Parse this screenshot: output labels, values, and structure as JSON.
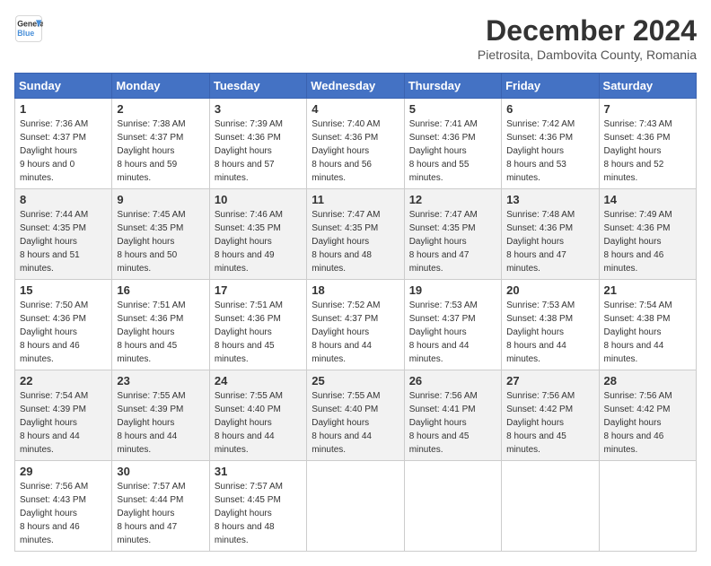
{
  "header": {
    "logo_line1": "General",
    "logo_line2": "Blue",
    "month": "December 2024",
    "location": "Pietrosita, Dambovita County, Romania"
  },
  "days_of_week": [
    "Sunday",
    "Monday",
    "Tuesday",
    "Wednesday",
    "Thursday",
    "Friday",
    "Saturday"
  ],
  "weeks": [
    [
      {
        "day": "1",
        "sunrise": "7:36 AM",
        "sunset": "4:37 PM",
        "daylight": "9 hours and 0 minutes."
      },
      {
        "day": "2",
        "sunrise": "7:38 AM",
        "sunset": "4:37 PM",
        "daylight": "8 hours and 59 minutes."
      },
      {
        "day": "3",
        "sunrise": "7:39 AM",
        "sunset": "4:36 PM",
        "daylight": "8 hours and 57 minutes."
      },
      {
        "day": "4",
        "sunrise": "7:40 AM",
        "sunset": "4:36 PM",
        "daylight": "8 hours and 56 minutes."
      },
      {
        "day": "5",
        "sunrise": "7:41 AM",
        "sunset": "4:36 PM",
        "daylight": "8 hours and 55 minutes."
      },
      {
        "day": "6",
        "sunrise": "7:42 AM",
        "sunset": "4:36 PM",
        "daylight": "8 hours and 53 minutes."
      },
      {
        "day": "7",
        "sunrise": "7:43 AM",
        "sunset": "4:36 PM",
        "daylight": "8 hours and 52 minutes."
      }
    ],
    [
      {
        "day": "8",
        "sunrise": "7:44 AM",
        "sunset": "4:35 PM",
        "daylight": "8 hours and 51 minutes."
      },
      {
        "day": "9",
        "sunrise": "7:45 AM",
        "sunset": "4:35 PM",
        "daylight": "8 hours and 50 minutes."
      },
      {
        "day": "10",
        "sunrise": "7:46 AM",
        "sunset": "4:35 PM",
        "daylight": "8 hours and 49 minutes."
      },
      {
        "day": "11",
        "sunrise": "7:47 AM",
        "sunset": "4:35 PM",
        "daylight": "8 hours and 48 minutes."
      },
      {
        "day": "12",
        "sunrise": "7:47 AM",
        "sunset": "4:35 PM",
        "daylight": "8 hours and 47 minutes."
      },
      {
        "day": "13",
        "sunrise": "7:48 AM",
        "sunset": "4:36 PM",
        "daylight": "8 hours and 47 minutes."
      },
      {
        "day": "14",
        "sunrise": "7:49 AM",
        "sunset": "4:36 PM",
        "daylight": "8 hours and 46 minutes."
      }
    ],
    [
      {
        "day": "15",
        "sunrise": "7:50 AM",
        "sunset": "4:36 PM",
        "daylight": "8 hours and 46 minutes."
      },
      {
        "day": "16",
        "sunrise": "7:51 AM",
        "sunset": "4:36 PM",
        "daylight": "8 hours and 45 minutes."
      },
      {
        "day": "17",
        "sunrise": "7:51 AM",
        "sunset": "4:36 PM",
        "daylight": "8 hours and 45 minutes."
      },
      {
        "day": "18",
        "sunrise": "7:52 AM",
        "sunset": "4:37 PM",
        "daylight": "8 hours and 44 minutes."
      },
      {
        "day": "19",
        "sunrise": "7:53 AM",
        "sunset": "4:37 PM",
        "daylight": "8 hours and 44 minutes."
      },
      {
        "day": "20",
        "sunrise": "7:53 AM",
        "sunset": "4:38 PM",
        "daylight": "8 hours and 44 minutes."
      },
      {
        "day": "21",
        "sunrise": "7:54 AM",
        "sunset": "4:38 PM",
        "daylight": "8 hours and 44 minutes."
      }
    ],
    [
      {
        "day": "22",
        "sunrise": "7:54 AM",
        "sunset": "4:39 PM",
        "daylight": "8 hours and 44 minutes."
      },
      {
        "day": "23",
        "sunrise": "7:55 AM",
        "sunset": "4:39 PM",
        "daylight": "8 hours and 44 minutes."
      },
      {
        "day": "24",
        "sunrise": "7:55 AM",
        "sunset": "4:40 PM",
        "daylight": "8 hours and 44 minutes."
      },
      {
        "day": "25",
        "sunrise": "7:55 AM",
        "sunset": "4:40 PM",
        "daylight": "8 hours and 44 minutes."
      },
      {
        "day": "26",
        "sunrise": "7:56 AM",
        "sunset": "4:41 PM",
        "daylight": "8 hours and 45 minutes."
      },
      {
        "day": "27",
        "sunrise": "7:56 AM",
        "sunset": "4:42 PM",
        "daylight": "8 hours and 45 minutes."
      },
      {
        "day": "28",
        "sunrise": "7:56 AM",
        "sunset": "4:42 PM",
        "daylight": "8 hours and 46 minutes."
      }
    ],
    [
      {
        "day": "29",
        "sunrise": "7:56 AM",
        "sunset": "4:43 PM",
        "daylight": "8 hours and 46 minutes."
      },
      {
        "day": "30",
        "sunrise": "7:57 AM",
        "sunset": "4:44 PM",
        "daylight": "8 hours and 47 minutes."
      },
      {
        "day": "31",
        "sunrise": "7:57 AM",
        "sunset": "4:45 PM",
        "daylight": "8 hours and 48 minutes."
      },
      null,
      null,
      null,
      null
    ]
  ]
}
